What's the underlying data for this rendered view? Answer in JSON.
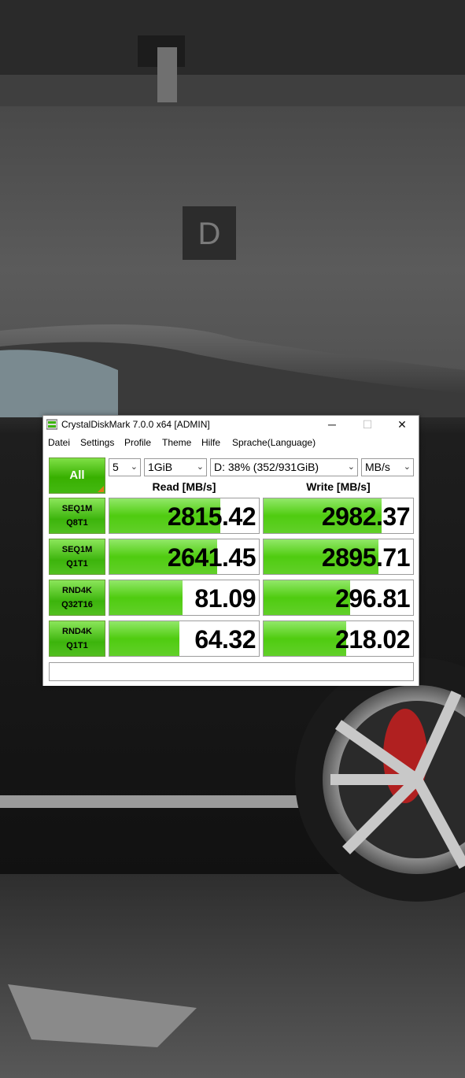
{
  "window": {
    "title": "CrystalDiskMark 7.0.0 x64 [ADMIN]",
    "controls": {
      "minimize": "─",
      "maximize": "☐",
      "close": "✕"
    }
  },
  "menu": [
    "Datei",
    "Settings",
    "Profile",
    "Theme",
    "Hilfe",
    "Sprache(Language)"
  ],
  "controls": {
    "all_label": "All",
    "count": "5",
    "size": "1GiB",
    "drive": "D: 38% (352/931GiB)",
    "unit": "MB/s"
  },
  "headers": {
    "read": "Read [MB/s]",
    "write": "Write [MB/s]"
  },
  "tests": [
    {
      "line1": "SEQ1M",
      "line2": "Q8T1",
      "read": "2815.42",
      "write": "2982.37",
      "read_fill": 0.74,
      "write_fill": 0.79
    },
    {
      "line1": "SEQ1M",
      "line2": "Q1T1",
      "read": "2641.45",
      "write": "2895.71",
      "read_fill": 0.72,
      "write_fill": 0.77
    },
    {
      "line1": "RND4K",
      "line2": "Q32T16",
      "read": "81.09",
      "write": "296.81",
      "read_fill": 0.49,
      "write_fill": 0.58
    },
    {
      "line1": "RND4K",
      "line2": "Q1T1",
      "read": "64.32",
      "write": "218.02",
      "read_fill": 0.47,
      "write_fill": 0.55
    }
  ],
  "status_text": "",
  "colors": {
    "bar_green": "#4fcc10",
    "button_green": "#3cb40c",
    "accent_orange": "#e07a18"
  }
}
